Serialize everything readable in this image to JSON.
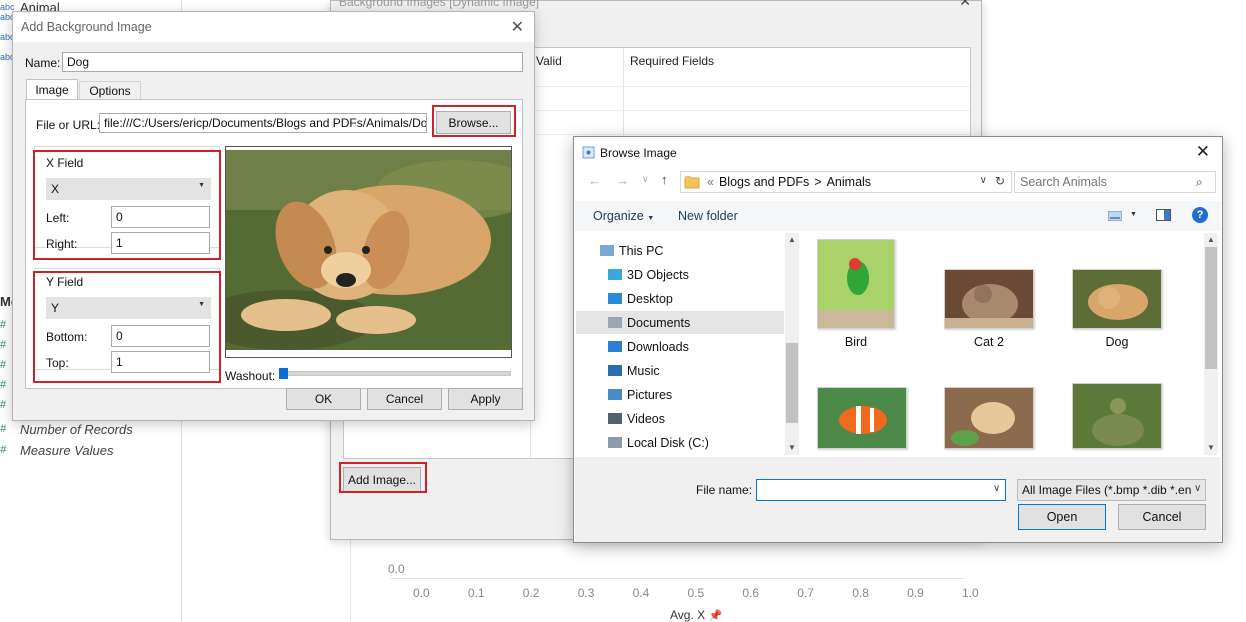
{
  "workspace": {
    "fields": {
      "animal": "Animal",
      "measures_header": "Mea",
      "number_of_records": "Number of Records",
      "measure_values": "Measure Values",
      "abc_glyph": "abc",
      "hash_glyph": "#"
    },
    "axis": {
      "y_tick": "0.0",
      "x_ticks": [
        "0.0",
        "0.1",
        "0.2",
        "0.3",
        "0.4",
        "0.5",
        "0.6",
        "0.7",
        "0.8",
        "0.9",
        "1.0"
      ],
      "x_label": "Avg. X"
    }
  },
  "bg_images_dialog": {
    "title": "Background Images [Dynamic Image]",
    "columns": [
      "Valid",
      "Required Fields"
    ],
    "add_image_label": "Add Image..."
  },
  "add_bg_dialog": {
    "title": "Add Background Image",
    "name_label": "Name:",
    "name_value": "Dog",
    "tabs": [
      "Image",
      "Options"
    ],
    "file_label": "File or URL:",
    "file_value": "file:///C:/Users/ericp/Documents/Blogs and PDFs/Animals/Dog.jpg",
    "browse_label": "Browse...",
    "x_field": {
      "title": "X Field",
      "selected": "X",
      "left_label": "Left:",
      "left_value": "0",
      "right_label": "Right:",
      "right_value": "1"
    },
    "y_field": {
      "title": "Y Field",
      "selected": "Y",
      "bottom_label": "Bottom:",
      "bottom_value": "0",
      "top_label": "Top:",
      "top_value": "1"
    },
    "washout_label": "Washout:",
    "washout_level": 0.0,
    "ok_label": "OK",
    "cancel_label": "Cancel",
    "apply_label": "Apply"
  },
  "browse_dialog": {
    "title": "Browse Image",
    "breadcrumb": [
      "Blogs and PDFs",
      "Animals"
    ],
    "breadcrumb_sep": ">",
    "search_placeholder": "Search Animals",
    "organize_label": "Organize",
    "new_folder_label": "New folder",
    "help_glyph": "?",
    "tree": [
      {
        "label": "This PC",
        "icon": "pc-icon"
      },
      {
        "label": "3D Objects",
        "icon": "3d-objects-icon"
      },
      {
        "label": "Desktop",
        "icon": "desktop-icon"
      },
      {
        "label": "Documents",
        "icon": "documents-icon",
        "selected": true
      },
      {
        "label": "Downloads",
        "icon": "downloads-icon"
      },
      {
        "label": "Music",
        "icon": "music-icon"
      },
      {
        "label": "Pictures",
        "icon": "pictures-icon"
      },
      {
        "label": "Videos",
        "icon": "videos-icon"
      },
      {
        "label": "Local Disk (C:)",
        "icon": "disk-icon"
      }
    ],
    "files": [
      {
        "label": "Bird"
      },
      {
        "label": "Cat 2"
      },
      {
        "label": "Dog"
      },
      {
        "label": ""
      },
      {
        "label": ""
      },
      {
        "label": ""
      }
    ],
    "file_name_label": "File name:",
    "file_name_value": "",
    "file_type_value": "All Image Files (*.bmp *.dib *.en",
    "open_label": "Open",
    "cancel_label": "Cancel"
  }
}
